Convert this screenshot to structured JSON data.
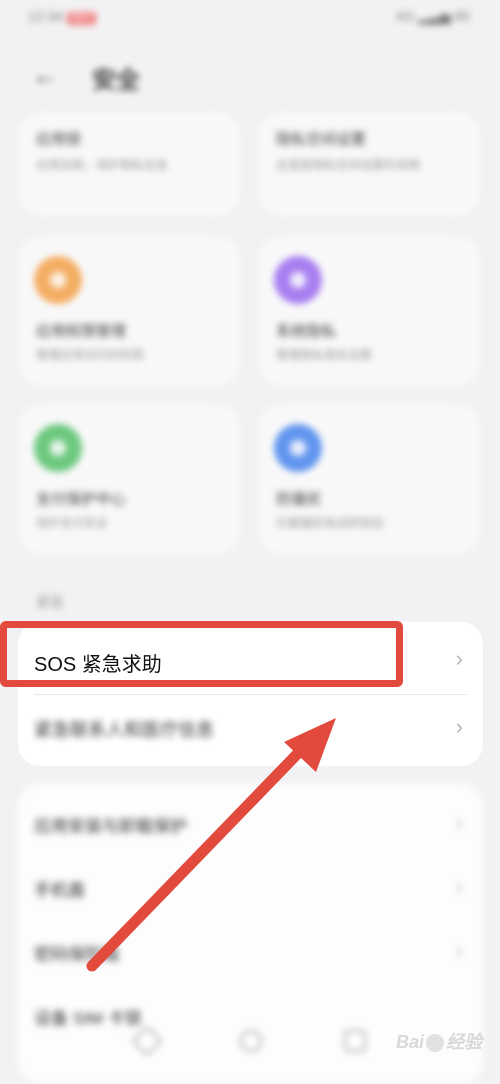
{
  "status_bar": {
    "time": "12:34",
    "recording_badge": "REC",
    "right_icons": "4G ▂▃▅ 85"
  },
  "header": {
    "title": "安全",
    "back_icon": "arrow-left-icon"
  },
  "cards": [
    {
      "title": "应用锁",
      "subtitle": "应用加锁，保护隐私信息"
    },
    {
      "title": "隐私空间设置",
      "subtitle": "这里是隐私空间设置的说明"
    },
    {
      "title": "应用权限管理",
      "subtitle": "管理应用访问的权限",
      "icon_color": "#f5a24a"
    },
    {
      "title": "系统隐私",
      "subtitle": "管理隐私相关设置",
      "icon_color": "#9b6bf0"
    },
    {
      "title": "支付保护中心",
      "subtitle": "保护支付安全",
      "icon_color": "#56c26a"
    },
    {
      "title": "防骚扰",
      "subtitle": "拦截骚扰电话和短信",
      "icon_color": "#4a86f0"
    }
  ],
  "section": {
    "label": "紧急"
  },
  "list_group_1": [
    {
      "label": "SOS 紧急求助"
    },
    {
      "label": "紧急联系人和医疗信息"
    }
  ],
  "list_group_2": [
    {
      "label": "应用安装与卸载保护"
    },
    {
      "label": "手机盾"
    },
    {
      "label": "密码保险箱"
    },
    {
      "label": "设备 SIM 卡锁"
    }
  ],
  "watermark": {
    "text_a": "Bai",
    "text_b": "经验"
  },
  "colors": {
    "highlight": "#e34a3e",
    "arrow": "#e34a3e",
    "background": "#f2f2f4"
  }
}
